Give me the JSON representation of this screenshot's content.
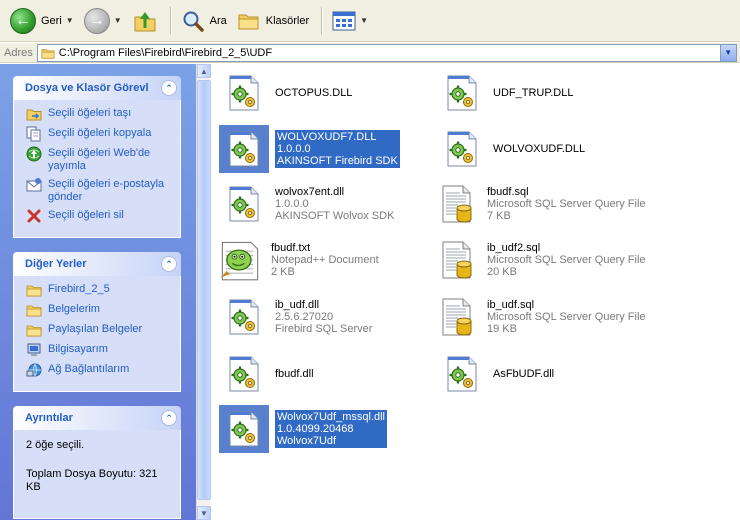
{
  "toolbar": {
    "back_label": "Geri",
    "search_label": "Ara",
    "folders_label": "Klasörler"
  },
  "address": {
    "label": "Adres",
    "path": "C:\\Program Files\\Firebird\\Firebird_2_5\\UDF"
  },
  "tasks_panel": {
    "title": "Dosya ve Klasör Görevl",
    "items": [
      {
        "label": "Seçili öğeleri taşı"
      },
      {
        "label": "Seçili öğeleri kopyala"
      },
      {
        "label": "Seçili öğeleri Web'de yayımla"
      },
      {
        "label": "Seçili öğeleri e-postayla gönder"
      },
      {
        "label": "Seçili öğeleri sil"
      }
    ]
  },
  "places_panel": {
    "title": "Diğer Yerler",
    "items": [
      {
        "label": "Firebird_2_5"
      },
      {
        "label": "Belgelerim"
      },
      {
        "label": "Paylaşılan Belgeler"
      },
      {
        "label": "Bilgisayarım"
      },
      {
        "label": "Ağ Bağlantılarım"
      }
    ]
  },
  "details_panel": {
    "title": "Ayrıntılar",
    "selected_count": "2 öğe seçili.",
    "total_size": "Toplam Dosya Boyutu: 321 KB"
  },
  "files": [
    {
      "name": "OCTOPUS.DLL",
      "line2": "",
      "line3": "",
      "icon": "dll-gear-icon",
      "selected": false
    },
    {
      "name": "UDF_TRUP.DLL",
      "line2": "",
      "line3": "",
      "icon": "dll-gear-icon",
      "selected": false
    },
    {
      "name": "WOLVOXUDF7.DLL",
      "line2": "1.0.0.0",
      "line3": "AKINSOFT Firebird SDK",
      "icon": "dll-gear-icon",
      "selected": true
    },
    {
      "name": "WOLVOXUDF.DLL",
      "line2": "",
      "line3": "",
      "icon": "dll-gear-icon",
      "selected": false
    },
    {
      "name": "wolvox7ent.dll",
      "line2": "1.0.0.0",
      "line3": "AKINSOFT Wolvox SDK",
      "icon": "dll-gear-icon",
      "selected": false
    },
    {
      "name": "fbudf.sql",
      "line2": "Microsoft SQL Server Query File",
      "line3": "7 KB",
      "icon": "sql-file-icon",
      "selected": false
    },
    {
      "name": "fbudf.txt",
      "line2": "Notepad++ Document",
      "line3": "2 KB",
      "icon": "notepad-file-icon",
      "selected": false
    },
    {
      "name": "ib_udf2.sql",
      "line2": "Microsoft SQL Server Query File",
      "line3": "20 KB",
      "icon": "sql-file-icon",
      "selected": false
    },
    {
      "name": "ib_udf.dll",
      "line2": "2.5.6.27020",
      "line3": "Firebird SQL Server",
      "icon": "dll-gear-icon",
      "selected": false
    },
    {
      "name": "ib_udf.sql",
      "line2": "Microsoft SQL Server Query File",
      "line3": "19 KB",
      "icon": "sql-file-icon",
      "selected": false
    },
    {
      "name": "fbudf.dll",
      "line2": "",
      "line3": "",
      "icon": "dll-gear-icon",
      "selected": false
    },
    {
      "name": "AsFbUDF.dll",
      "line2": "",
      "line3": "",
      "icon": "dll-gear-icon",
      "selected": false
    },
    {
      "name": "Wolvox7Udf_mssql.dll",
      "line2": "1.0.4099.20468",
      "line3": "Wolvox7Udf",
      "icon": "dll-gear-icon",
      "selected": true
    }
  ]
}
